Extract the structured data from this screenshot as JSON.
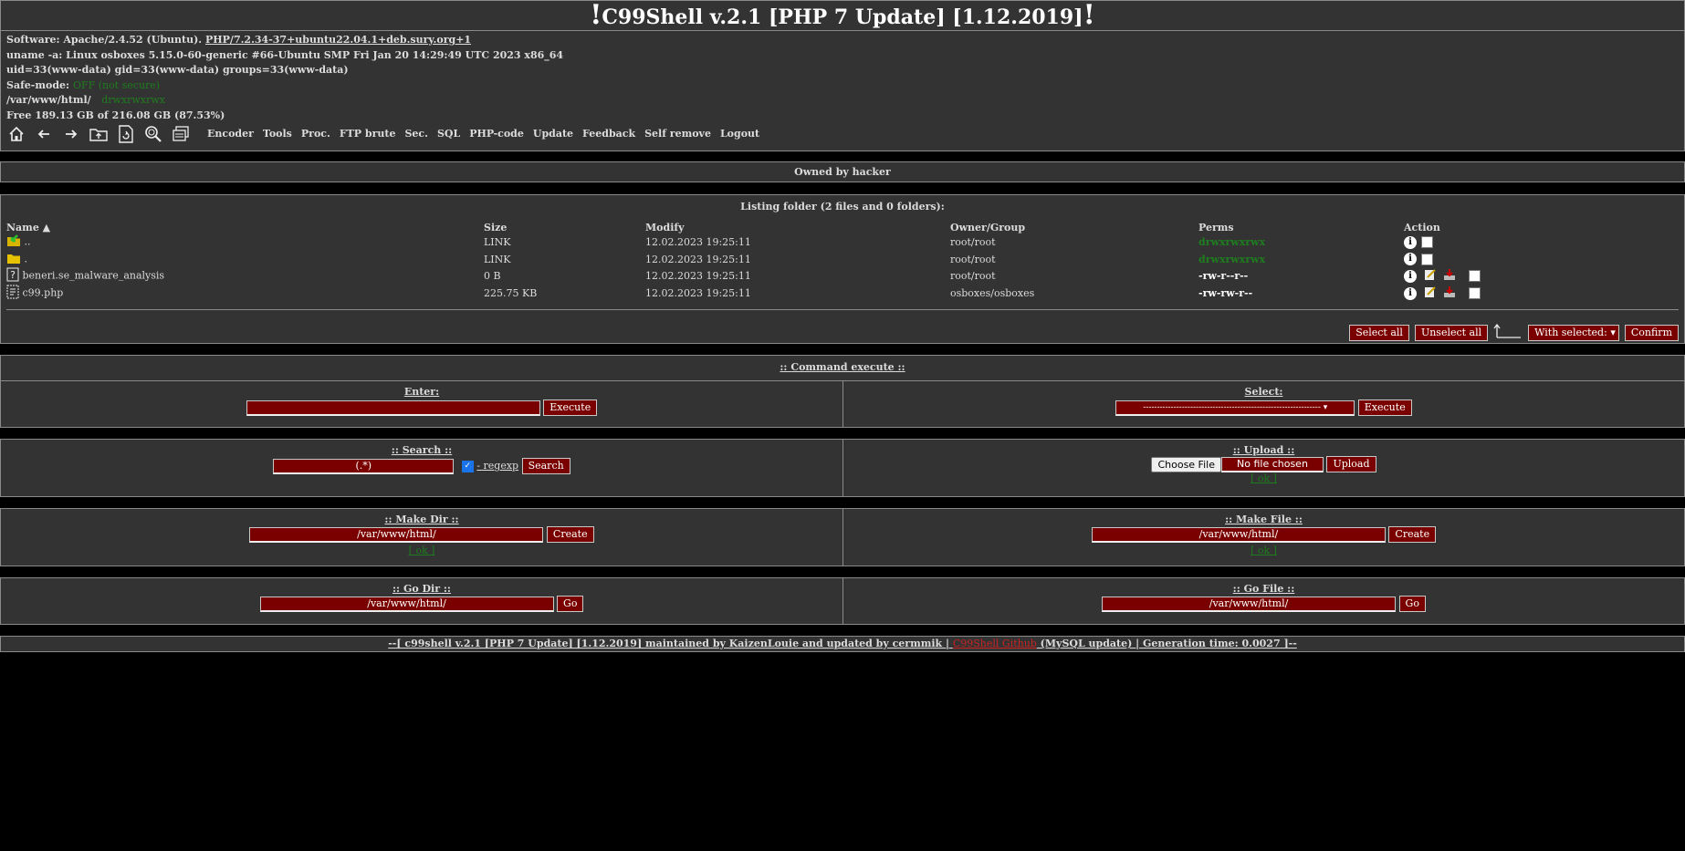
{
  "header": {
    "bang": "!",
    "title": "C99Shell v.2.1 [PHP 7 Update] [1.12.2019]"
  },
  "info": {
    "software_label": "Software: Apache/2.4.52 (Ubuntu). ",
    "software_link": "PHP/7.2.34-37+ubuntu22.04.1+deb.sury.org+1",
    "uname": "uname -a: Linux osboxes 5.15.0-60-generic #66-Ubuntu SMP Fri Jan 20 14:29:49 UTC 2023 x86_64",
    "uid": "uid=33(www-data) gid=33(www-data) groups=33(www-data)",
    "safemode_label": "Safe-mode: ",
    "safemode_value": "OFF (not secure)",
    "path": "/var/www/html/",
    "path_perms": "drwxrwxrwx",
    "free": "Free 189.13 GB of 216.08 GB (87.53%)"
  },
  "nav": {
    "icons": [
      "home-icon",
      "back-icon",
      "forward-icon",
      "up-folder-icon",
      "refresh-icon",
      "search-icon",
      "buffer-icon"
    ],
    "links": [
      "Encoder",
      "Tools",
      "Proc.",
      "FTP brute",
      "Sec.",
      "SQL",
      "PHP-code",
      "Update",
      "Feedback",
      "Self remove",
      "Logout"
    ]
  },
  "owned": "Owned by hacker",
  "listing": {
    "title": "Listing folder (2 files and 0 folders):",
    "columns": [
      "Name",
      "Size",
      "Modify",
      "Owner/Group",
      "Perms",
      "Action"
    ],
    "sort_marker": "▲",
    "rows": [
      {
        "name": "..",
        "size": "LINK",
        "modify": "12.02.2023 19:25:11",
        "owner": "root/root",
        "perms": "drwxrwxrwx",
        "perm_color": "green",
        "icon": "parent-folder-icon",
        "actions": "dir"
      },
      {
        "name": ".",
        "size": "LINK",
        "modify": "12.02.2023 19:25:11",
        "owner": "root/root",
        "perms": "drwxrwxrwx",
        "perm_color": "green",
        "icon": "folder-icon",
        "actions": "dir"
      },
      {
        "name": "beneri.se_malware_analysis",
        "size": "0 B",
        "modify": "12.02.2023 19:25:11",
        "owner": "root/root",
        "perms": "-rw-r--r--",
        "perm_color": "white",
        "icon": "unknown-file-icon",
        "actions": "file"
      },
      {
        "name": "c99.php",
        "size": "225.75 KB",
        "modify": "12.02.2023 19:25:11",
        "owner": "osboxes/osboxes",
        "perms": "-rw-rw-r--",
        "perm_color": "white",
        "icon": "php-file-icon",
        "actions": "file"
      }
    ],
    "select_all": "Select all",
    "unselect_all": "Unselect all",
    "with_selected": "With selected:",
    "confirm": "Confirm"
  },
  "cmd": {
    "title": ":: Command execute ::",
    "enter_label": "Enter:",
    "execute": "Execute",
    "select_label": "Select:",
    "select_value": "----------------------------------------------------------------"
  },
  "search": {
    "title": ":: Search ::",
    "value": "(.*)",
    "regexp": " - regexp",
    "button": "Search"
  },
  "upload": {
    "title": ":: Upload ::",
    "choose": "Choose File",
    "no_file": "No file chosen",
    "button": "Upload",
    "ok": "[ ok ]"
  },
  "makedir": {
    "title": ":: Make Dir ::",
    "value": "/var/www/html/",
    "button": "Create",
    "ok": "[ ok ]"
  },
  "makefile": {
    "title": ":: Make File ::",
    "value": "/var/www/html/",
    "button": "Create",
    "ok": "[ ok ]"
  },
  "godir": {
    "title": ":: Go Dir ::",
    "value": "/var/www/html/",
    "button": "Go"
  },
  "gofile": {
    "title": ":: Go File ::",
    "value": "/var/www/html/",
    "button": "Go"
  },
  "footer": {
    "part1": "--[ c99shell v.2.1 [PHP 7 Update] [1.12.2019] maintained by KaizenLouie and updated by cermmik | ",
    "github": "C99Shell Github",
    "part2": " (MySQL update) | Generation time: 0.0027 ]--"
  },
  "colors": {
    "background": "#000000",
    "panel": "#333333",
    "button": "#7a0000",
    "green": "#1e7d1e",
    "github": "#cc2222"
  }
}
